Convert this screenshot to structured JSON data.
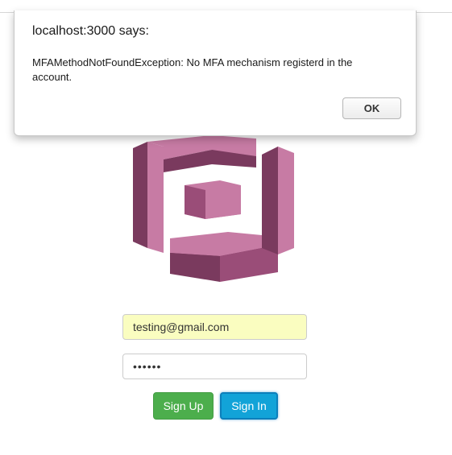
{
  "dialog": {
    "title": "localhost:3000 says:",
    "message": "MFAMethodNotFoundException: No MFA mechanism registerd in the account.",
    "ok_label": "OK"
  },
  "form": {
    "email_value": "testing@gmail.com",
    "password_value": "••••••",
    "signup_label": "Sign Up",
    "signin_label": "Sign In"
  },
  "colors": {
    "logo_light": "#c77ba4",
    "logo_mid": "#9a4d78",
    "logo_dark": "#7a3a5e",
    "signup": "#4cae4c",
    "signin": "#12a3d8",
    "autofill": "#fafdc0"
  },
  "icons": {
    "logo": "aws-cognito-logo"
  }
}
